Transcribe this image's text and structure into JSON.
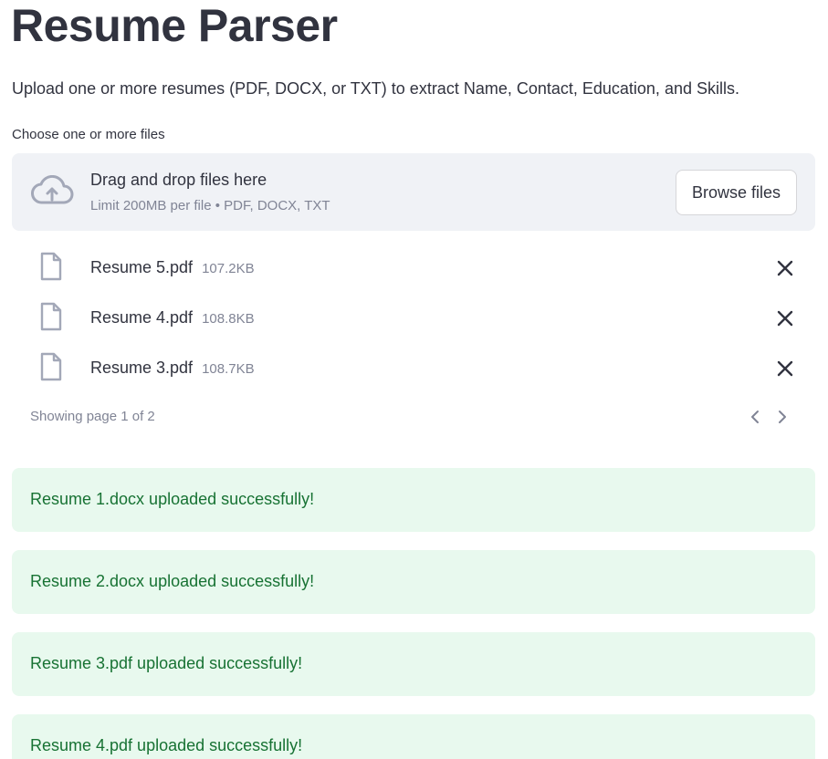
{
  "header": {
    "title": "Resume Parser",
    "subtitle": "Upload one or more resumes (PDF, DOCX, or TXT) to extract Name, Contact, Education, and Skills."
  },
  "uploader": {
    "label": "Choose one or more files",
    "drop_text": "Drag and drop files here",
    "limit_text": "Limit 200MB per file • PDF, DOCX, TXT",
    "browse_label": "Browse files",
    "icon": "cloud-upload-icon"
  },
  "files": [
    {
      "name": "Resume 5.pdf",
      "size": "107.2KB"
    },
    {
      "name": "Resume 4.pdf",
      "size": "108.8KB"
    },
    {
      "name": "Resume 3.pdf",
      "size": "108.7KB"
    }
  ],
  "pagination": {
    "text": "Showing page 1 of 2"
  },
  "alerts": [
    "Resume 1.docx uploaded successfully!",
    "Resume 2.docx uploaded successfully!",
    "Resume 3.pdf uploaded successfully!",
    "Resume 4.pdf uploaded successfully!"
  ],
  "colors": {
    "text": "#31333f",
    "muted": "#808495",
    "dropzone_bg": "#f0f2f6",
    "success_bg": "#e8f9ee",
    "success_text": "#177233"
  }
}
